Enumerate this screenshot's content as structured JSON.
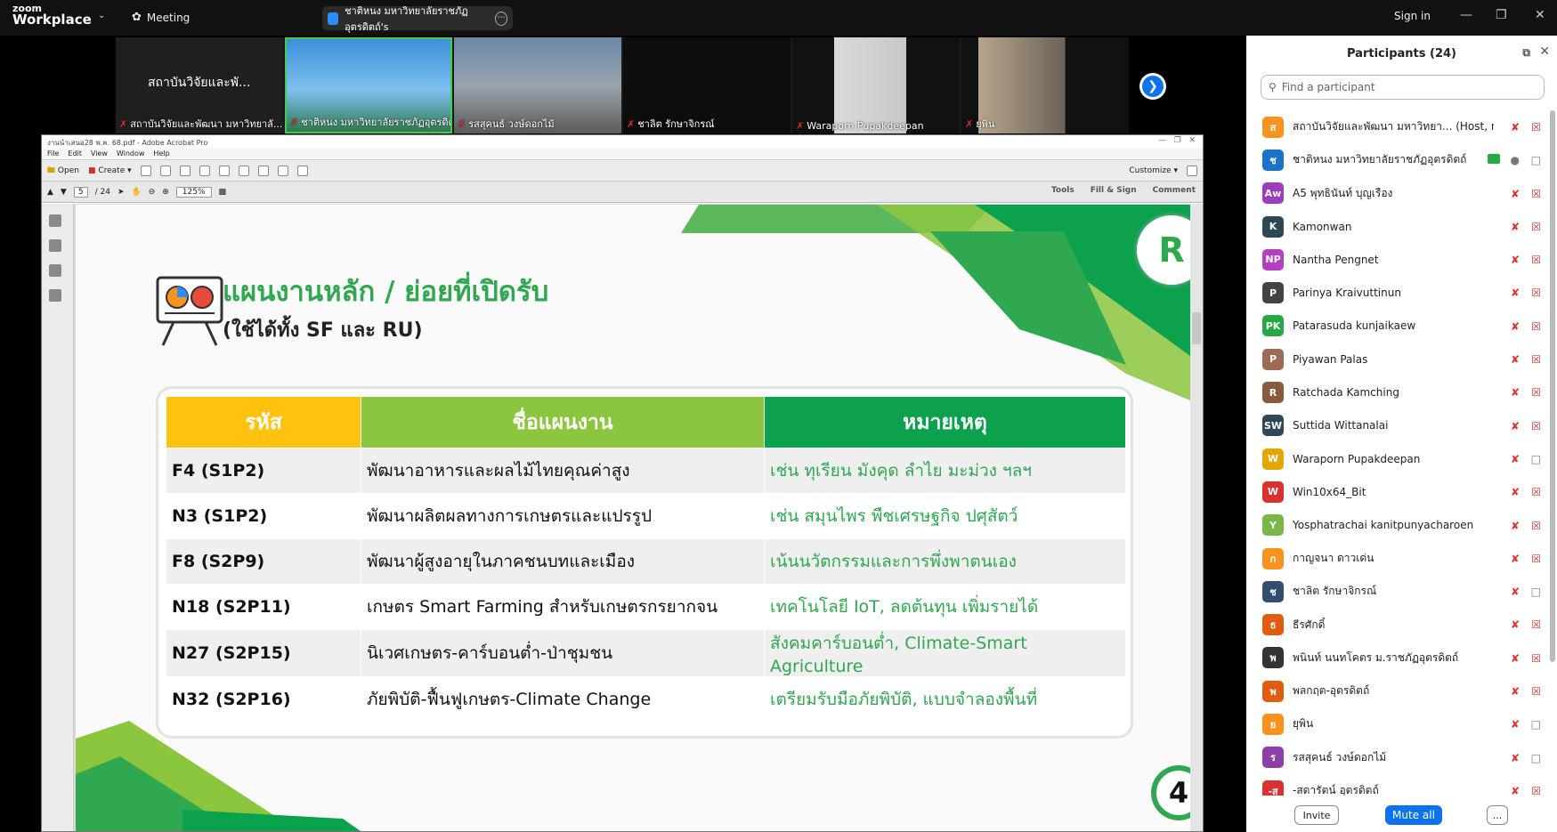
{
  "app": {
    "logo_small": "zoom",
    "logo_big": "Workplace",
    "meeting_label": "Meeting",
    "share_title": "ชาติหนง มหาวิทยาลัยราชภัฏอุตรดิตถ์'s",
    "signin": "Sign in"
  },
  "strip": {
    "tiles": [
      {
        "name": "สถาบันวิจัยและพัฒนา มหาวิทยาลั...",
        "big": "สถาบันวิจัยและพั..."
      },
      {
        "name": "ชาติหนง มหาวิทยาลัยราชภัฏอุตรดิตถ์"
      },
      {
        "name": "รสสุคนธ์ วงษ์ดอกไม้"
      },
      {
        "name": "ชาลิต รักษาจิกรณ์"
      },
      {
        "name": "Waraporn Pupakdeepan"
      },
      {
        "name": "ยุพิน"
      }
    ]
  },
  "acrobat": {
    "title": "งานนำเสนอ28 พ.ค. 68.pdf - Adobe Acrobat Pro",
    "menu": [
      "File",
      "Edit",
      "View",
      "Window",
      "Help"
    ],
    "open": "Open",
    "create": "Create",
    "customize": "Customize",
    "page_current": "5",
    "page_total": "/ 24",
    "zoom": "125%",
    "right_tabs": [
      "Tools",
      "Fill & Sign",
      "Comment"
    ]
  },
  "slide": {
    "title": "แผนงานหลัก / ย่อยที่เปิดรับ",
    "subtitle": "(ใช้ได้ทั้ง SF และ RU)",
    "headers": [
      "รหัส",
      "ชื่อแผนงาน",
      "หมายเหตุ"
    ],
    "header_colors": [
      "#ffc20e",
      "#8cc63f",
      "#0ca14c"
    ],
    "rows": [
      [
        "F4 (S1P2)",
        "พัฒนาอาหารและผลไม้ไทยคุณค่าสูง",
        "เช่น ทุเรียน มังคุด ลำไย มะม่วง ฯลฯ"
      ],
      [
        "N3 (S1P2)",
        "พัฒนาผลิตผลทางการเกษตรและแปรรูป",
        "เช่น สมุนไพร พืชเศรษฐกิจ ปศุสัตว์"
      ],
      [
        "F8 (S2P9)",
        "พัฒนาผู้สูงอายุในภาคชนบทและเมือง",
        "เน้นนวัตกรรมและการพึ่งพาตนเอง"
      ],
      [
        "N18 (S2P11)",
        "เกษตร Smart Farming สำหรับเกษตรกรยากจน",
        "เทคโนโลยี IoT, ลดต้นทุน เพิ่มรายได้"
      ],
      [
        "N27 (S2P15)",
        "นิเวศเกษตร-คาร์บอนต่ำ-ป่าชุมชน",
        "สังคมคาร์บอนต่ำ, Climate-Smart Agriculture"
      ],
      [
        "N32 (S2P16)",
        "ภัยพิบัติ-ฟื้นฟูเกษตร-Climate Change",
        "เตรียมรับมือภัยพิบัติ, แบบจำลองพื้นที่"
      ]
    ],
    "page_number": "4",
    "logo_letter": "R"
  },
  "panel": {
    "title": "Participants (24)",
    "search_placeholder": "Find a participant",
    "participants": [
      {
        "initial": "ส",
        "color": "#f7931e",
        "name": "สถาบันวิจัยและพัฒนา มหาวิทยา... (Host, me)",
        "mic": "off",
        "cam": "off"
      },
      {
        "initial": "ช",
        "color": "#1a73c9",
        "name": "ชาติหนง มหาวิทยาลัยราชภัฏอุตรดิตถ์",
        "mic": "on",
        "cam": "on",
        "share": true
      },
      {
        "initial": "Aw",
        "color": "#9b3dbf",
        "name": "A5 พุทธินันท์ บุญเรือง",
        "mic": "off",
        "cam": "off"
      },
      {
        "initial": "K",
        "color": "#2f4858",
        "name": "Kamonwan",
        "mic": "off",
        "cam": "off"
      },
      {
        "initial": "NP",
        "color": "#b43fbf",
        "name": "Nantha Pengnet",
        "mic": "off",
        "cam": "off"
      },
      {
        "initial": "P",
        "color": "#444444",
        "name": "Parinya Kraivuttinun",
        "mic": "off",
        "cam": "off"
      },
      {
        "initial": "PK",
        "color": "#27a844",
        "name": "Patarasuda kunjaikaew",
        "mic": "off",
        "cam": "off"
      },
      {
        "initial": "P",
        "color": "#9c6b55",
        "name": "Piyawan Palas",
        "mic": "off",
        "cam": "off"
      },
      {
        "initial": "R",
        "color": "#8a5a3c",
        "name": "Ratchada Kamching",
        "mic": "off",
        "cam": "off"
      },
      {
        "initial": "SW",
        "color": "#2f4858",
        "name": "Suttida Wittanalai",
        "mic": "off",
        "cam": "off"
      },
      {
        "initial": "W",
        "color": "#e0a800",
        "name": "Waraporn Pupakdeepan",
        "mic": "off",
        "cam": "on"
      },
      {
        "initial": "W",
        "color": "#d93030",
        "name": "Win10x64_Bit",
        "mic": "off",
        "cam": "off"
      },
      {
        "initial": "Y",
        "color": "#7ab648",
        "name": "Yosphatrachai kanitpunyacharoen",
        "mic": "off",
        "cam": "off"
      },
      {
        "initial": "ก",
        "color": "#f7931e",
        "name": "กาญจนา ดาวเด่น",
        "mic": "off",
        "cam": "off"
      },
      {
        "initial": "ช",
        "color": "#344d6e",
        "name": "ชาลิต รักษาจิกรณ์",
        "mic": "off",
        "cam": "on"
      },
      {
        "initial": "ธ",
        "color": "#e05d10",
        "name": "ธีรศักดิ์",
        "mic": "off",
        "cam": "off"
      },
      {
        "initial": "พ",
        "color": "#333333",
        "name": "พนินท์ นนทโคตร ม.ราชภัฏอุตรดิตถ์",
        "mic": "off",
        "cam": "off"
      },
      {
        "initial": "พ",
        "color": "#e05d10",
        "name": "พลกฤต-อุตรดิตถ์",
        "mic": "off",
        "cam": "off"
      },
      {
        "initial": "ย",
        "color": "#f7931e",
        "name": "ยุพิน",
        "mic": "off",
        "cam": "on"
      },
      {
        "initial": "ร",
        "color": "#8e3fa5",
        "name": "รสสุคนธ์ วงษ์ดอกไม้",
        "mic": "off",
        "cam": "on"
      },
      {
        "initial": "-ส",
        "color": "#d93030",
        "name": "-สดารัตน์ อุตรดิตถ์",
        "mic": "off",
        "cam": "off"
      }
    ],
    "invite": "Invite",
    "mute_all": "Mute all",
    "more": "..."
  }
}
